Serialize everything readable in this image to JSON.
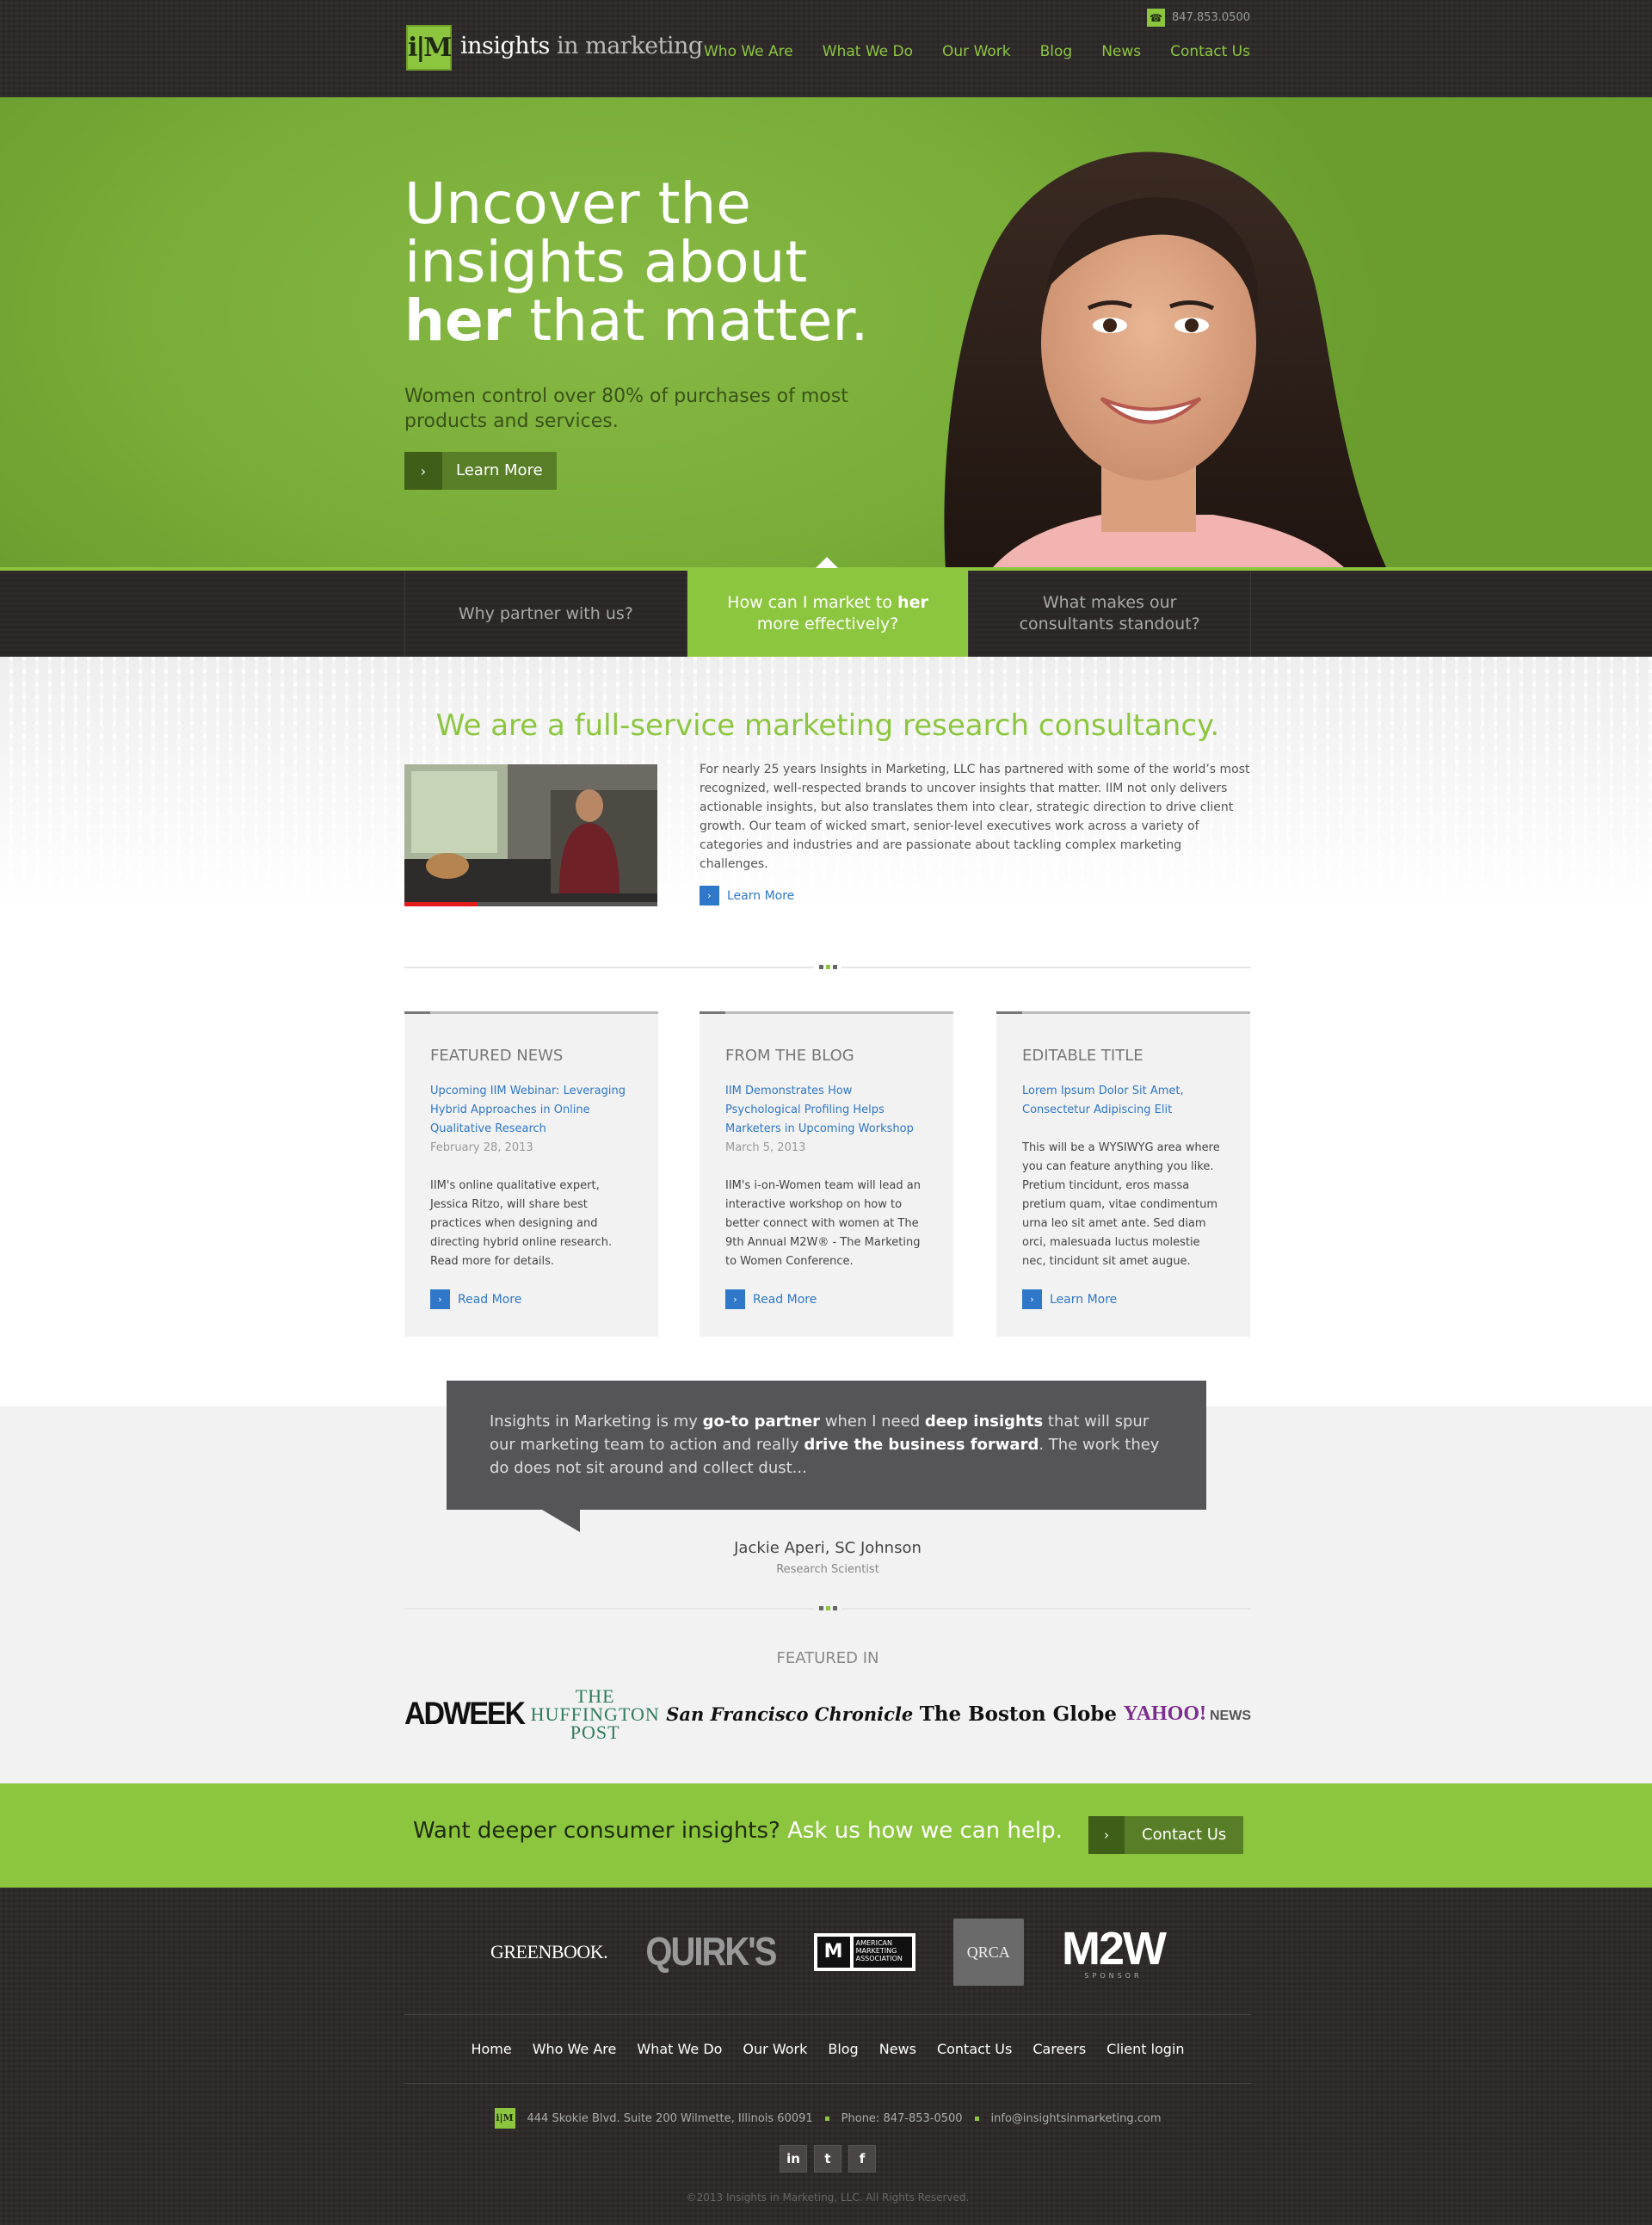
{
  "header": {
    "logo_mark": "i|M",
    "logo_word1": "insights",
    "logo_word2": "in marketing",
    "phone": "847.853.0500",
    "nav": [
      "Who We Are",
      "What We Do",
      "Our Work",
      "Blog",
      "News",
      "Contact Us"
    ]
  },
  "hero": {
    "title_line1": "Uncover the",
    "title_line2": "insights about",
    "title_bold": "her",
    "title_rest": " that matter.",
    "subtitle": "Women control over 80% of purchases of most products and services.",
    "button": "Learn More"
  },
  "tabs": {
    "tab1": "Why partner with us?",
    "tab2_pre": "How can I market to ",
    "tab2_bold": "her",
    "tab2_post": " more effectively?",
    "tab3": "What makes our consultants standout?"
  },
  "intro": {
    "title": "We are a full-service marketing research consultancy.",
    "body": "For nearly 25 years Insights in Marketing, LLC has partnered with some of the world’s most recognized, well-respected brands to uncover insights that matter. IIM not only delivers actionable insights, but also translates them into clear, strategic direction to drive client growth. Our team of wicked smart, senior-level executives work across a variety of categories and industries and are passionate about tackling complex marketing challenges.",
    "link": "Learn More"
  },
  "cards": [
    {
      "title": "FEATURED NEWS",
      "headline": "Upcoming IIM Webinar: Leveraging Hybrid Approaches in Online Qualitative Research",
      "date": "February 28, 2013",
      "body": "IIM's online qualitative expert, Jessica Ritzo, will share best practices when designing and directing hybrid online research. Read more for details.",
      "link": "Read More"
    },
    {
      "title": "FROM THE BLOG",
      "headline": "IIM Demonstrates How Psychological Profiling Helps Marketers in Upcoming Workshop",
      "date": "March 5, 2013",
      "body": "IIM's i-on-Women team will lead an interactive workshop on how to better connect with women at The 9th Annual M2W® - The Marketing to Women Conference.",
      "link": "Read More"
    },
    {
      "title": "EDITABLE TITLE",
      "headline": "Lorem Ipsum Dolor Sit Amet, Consectetur Adipiscing Elit",
      "date": "",
      "body": "This will be a WYSIWYG area where you can feature anything you like. Pretium tincidunt, eros massa pretium quam, vitae condimentum urna leo sit amet ante. Sed diam orci, malesuada luctus molestie nec, tincidunt sit amet augue.",
      "link": "Learn More"
    }
  ],
  "testimonial": {
    "p1": "Insights in Marketing is my ",
    "b1": "go-to partner",
    "p2": " when I need ",
    "b2": "deep insights",
    "p3": " that will spur our marketing team to action and really ",
    "b3": "drive the business forward",
    "p4": ". The work they do does not sit around and collect dust...",
    "author": "Jackie Aperi, SC Johnson",
    "role": "Research Scientist"
  },
  "featured": {
    "label": "FEATURED IN",
    "logos": {
      "adweek": "ADWEEK",
      "huff1": "THE",
      "huff2": "HUFFINGTON",
      "huff3": "POST",
      "sfc": "San Francisco Chronicle",
      "bg": "The Boston Globe",
      "yahoo": "YAHOO!",
      "yahoo_news": "NEWS"
    }
  },
  "cta": {
    "dark": "Want deeper consumer insights?",
    "light": " Ask us how we can help.",
    "button": "Contact Us"
  },
  "footer": {
    "partners": {
      "greenbook": "GREENBOOK.",
      "quirks": "QUIRK'S",
      "ama_mark": "M",
      "ama_text": "AMERICAN MARKETING ASSOCIATION",
      "qrca": "QRCA",
      "m2w": "M2W",
      "m2w_sub": "SPONSOR"
    },
    "nav": [
      "Home",
      "Who We Are",
      "What We Do",
      "Our Work",
      "Blog",
      "News",
      "Contact Us",
      "Careers",
      "Client login"
    ],
    "im_mark": "i|M",
    "address": "444 Skokie Blvd. Suite 200 Wilmette, Illinois 60091",
    "phone": "Phone: 847-853-0500",
    "email": "info@insightsinmarketing.com",
    "social": [
      "in",
      "t",
      "f"
    ],
    "copyright": "©2013 Insights in Marketing, LLC. All Rights Reserved."
  },
  "colors": {
    "accent": "#8cc63f",
    "dark": "#2a2626",
    "link": "#2e77c9",
    "quote": "#555557"
  }
}
